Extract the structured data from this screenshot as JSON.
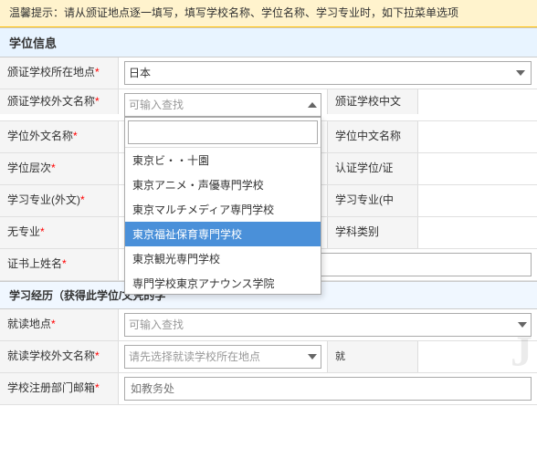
{
  "warning": {
    "text": "温馨提示：请从颁证地点逐一填写，填写学校名称、学位名称、学习专业时，如下拉菜单选项"
  },
  "section1": {
    "title": "学位信息"
  },
  "fields": {
    "country": {
      "label": "颁证学校所在地点",
      "required": true,
      "value": "日本"
    },
    "school_foreign": {
      "label": "颁证学校外文名称",
      "required": true,
      "placeholder": "可输入查找"
    },
    "school_chinese_label": "颁证学校中文",
    "school_name_foreign": {
      "label": "学位外文名称",
      "required": true
    },
    "school_name_chinese_label": "学位中文名称",
    "degree_level": {
      "label": "学位层次",
      "required": true
    },
    "cert_level_label": "认证学位/证",
    "major_foreign": {
      "label": "学习专业(外文)",
      "required": true
    },
    "major_chinese_label": "学习专业(中",
    "no_major": {
      "label": "无专业",
      "required": true
    },
    "subject_label": "学科类别",
    "cert_name": {
      "label": "证书上姓名",
      "required": true
    }
  },
  "dropdown": {
    "placeholder": "可输入查找",
    "search_placeholder": "",
    "items": [
      {
        "text": "東京ビ・・十園",
        "selected": false
      },
      {
        "text": "東京アニメ・声優専門学校",
        "selected": false
      },
      {
        "text": "東京マルチメディア専門学校",
        "selected": false
      },
      {
        "text": "東京福祉保育専門学校",
        "selected": true
      },
      {
        "text": "東京観光専門学校",
        "selected": false
      },
      {
        "text": "専門学校東京アナウンス学院",
        "selected": false
      }
    ]
  },
  "section2": {
    "title": "学习经历（获得此学位/文凭的学"
  },
  "history_fields": {
    "study_location": {
      "label": "就读地点",
      "required": true,
      "placeholder": "可输入查找"
    },
    "study_school": {
      "label": "就读学校外文名称",
      "required": true,
      "placeholder": "请先选择就读学校所在地点"
    },
    "study_school_chinese_label": "就",
    "school_dept": {
      "label": "学校注册部门邮箱",
      "required": true,
      "placeholder": "如教务处"
    }
  },
  "colors": {
    "selected_bg": "#4a90d9",
    "header_bg": "#e8f4ff",
    "label_bg": "#f5f5f5",
    "warning_bg": "#fff3cd"
  }
}
